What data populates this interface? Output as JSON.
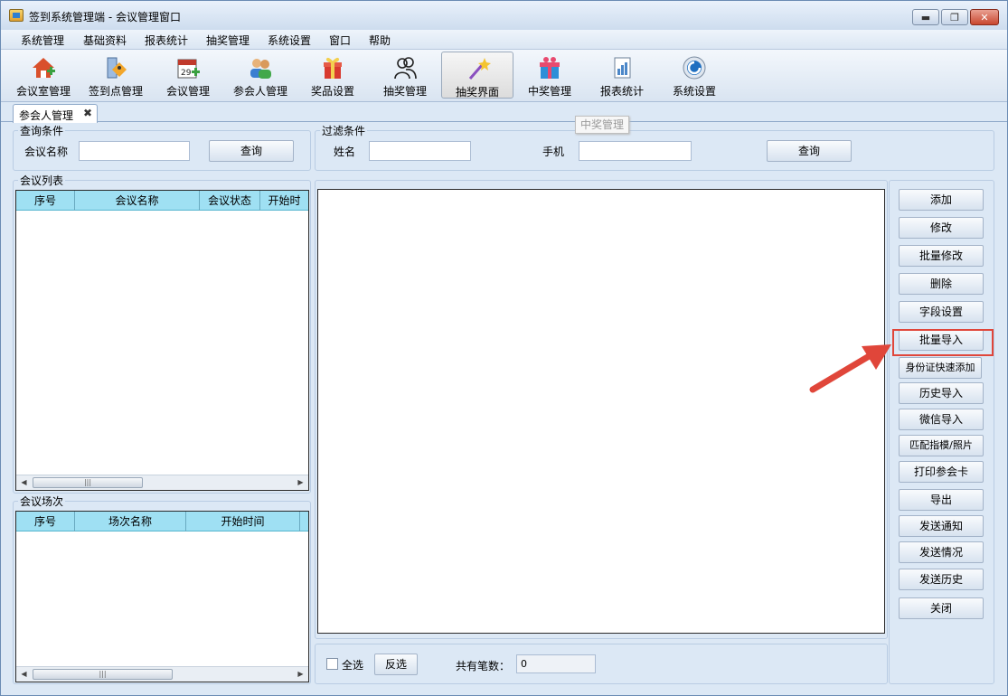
{
  "window": {
    "title": "签到系统管理端 - 会议管理窗口",
    "controls": [
      "▬",
      "❐",
      "✕"
    ]
  },
  "menu": [
    "系统管理",
    "基础资料",
    "报表统计",
    "抽奖管理",
    "系统设置",
    "窗口",
    "帮助"
  ],
  "toolbar": [
    {
      "label": "会议室管理",
      "icon": "house-add-icon"
    },
    {
      "label": "签到点管理",
      "icon": "signin-point-icon"
    },
    {
      "label": "会议管理",
      "icon": "calendar-add-icon"
    },
    {
      "label": "参会人管理",
      "icon": "users-icon"
    },
    {
      "label": "奖品设置",
      "icon": "gift-box-icon"
    },
    {
      "label": "抽奖管理",
      "icon": "people-outline-icon"
    },
    {
      "label": "抽奖界面",
      "icon": "magic-wand-icon"
    },
    {
      "label": "中奖管理",
      "icon": "gift-ribbon-icon"
    },
    {
      "label": "报表统计",
      "icon": "report-icon"
    },
    {
      "label": "系统设置",
      "icon": "settings-disc-icon"
    }
  ],
  "tabs": [
    {
      "label": "参会人管理",
      "close": "✖"
    }
  ],
  "tooltip": "中奖管理",
  "query": {
    "title": "查询条件",
    "meeting_name_label": "会议名称",
    "meeting_name_value": "",
    "search_button": "查询"
  },
  "filter": {
    "title": "过滤条件",
    "name_label": "姓名",
    "name_value": "",
    "phone_label": "手机",
    "phone_value": "",
    "search_button": "查询"
  },
  "meeting_list": {
    "title": "会议列表",
    "columns": [
      "序号",
      "会议名称",
      "会议状态",
      "开始时"
    ]
  },
  "sessions": {
    "title": "会议场次",
    "columns": [
      "序号",
      "场次名称",
      "开始时间"
    ]
  },
  "scroll": {
    "left": "◀",
    "right": "▶",
    "grip": "|||"
  },
  "side_buttons": [
    "添加",
    "修改",
    "批量修改",
    "删除",
    "字段设置",
    "批量导入",
    "身份证快速添加",
    "历史导入",
    "微信导入",
    "匹配指模/照片",
    "打印参会卡",
    "导出",
    "发送通知",
    "发送情况",
    "发送历史",
    "关闭"
  ],
  "footer": {
    "select_all_label": "全选",
    "invert_button": "反选",
    "total_label": "共有笔数：",
    "total_value": "0"
  },
  "colors": {
    "annotation": "#e0463a",
    "grid_header": "#9fe0f3"
  }
}
